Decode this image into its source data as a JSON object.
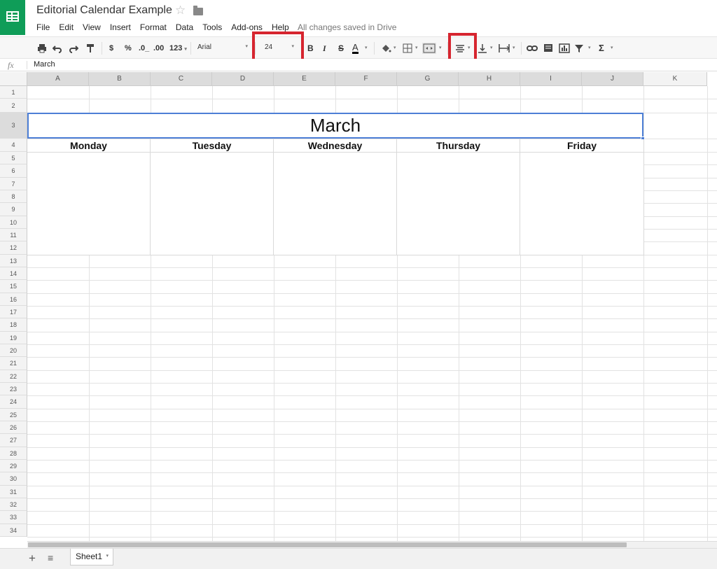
{
  "app": {
    "title": "Editorial Calendar Example",
    "status": "All changes saved in Drive"
  },
  "menu": [
    "File",
    "Edit",
    "View",
    "Insert",
    "Format",
    "Data",
    "Tools",
    "Add-ons",
    "Help"
  ],
  "toolbar": {
    "currency": "$",
    "percent": "%",
    "decrease_decimal": ".0_",
    "increase_decimal": ".00",
    "more_formats": "123",
    "font": "Arial",
    "font_size": "24",
    "bold": "B",
    "italic": "I",
    "strikethrough": "S",
    "text_color": "A",
    "sum": "Σ",
    "highlight_color": "#d6252f"
  },
  "formula_bar": {
    "fx": "fx",
    "value": "March"
  },
  "columns": [
    "A",
    "B",
    "C",
    "D",
    "E",
    "F",
    "G",
    "H",
    "I",
    "J",
    "K"
  ],
  "rows": [
    "1",
    "2",
    "3",
    "4",
    "5",
    "6",
    "7",
    "8",
    "9",
    "10",
    "11",
    "12",
    "13",
    "14",
    "15",
    "16",
    "17",
    "18",
    "19",
    "20",
    "21",
    "22",
    "23",
    "24",
    "25",
    "26",
    "27",
    "28",
    "29",
    "30",
    "31",
    "32",
    "33",
    "34"
  ],
  "calendar": {
    "month": "March",
    "days": [
      "Monday",
      "Tuesday",
      "Wednesday",
      "Thursday",
      "Friday"
    ]
  },
  "sheets": [
    {
      "name": "Sheet1"
    }
  ]
}
